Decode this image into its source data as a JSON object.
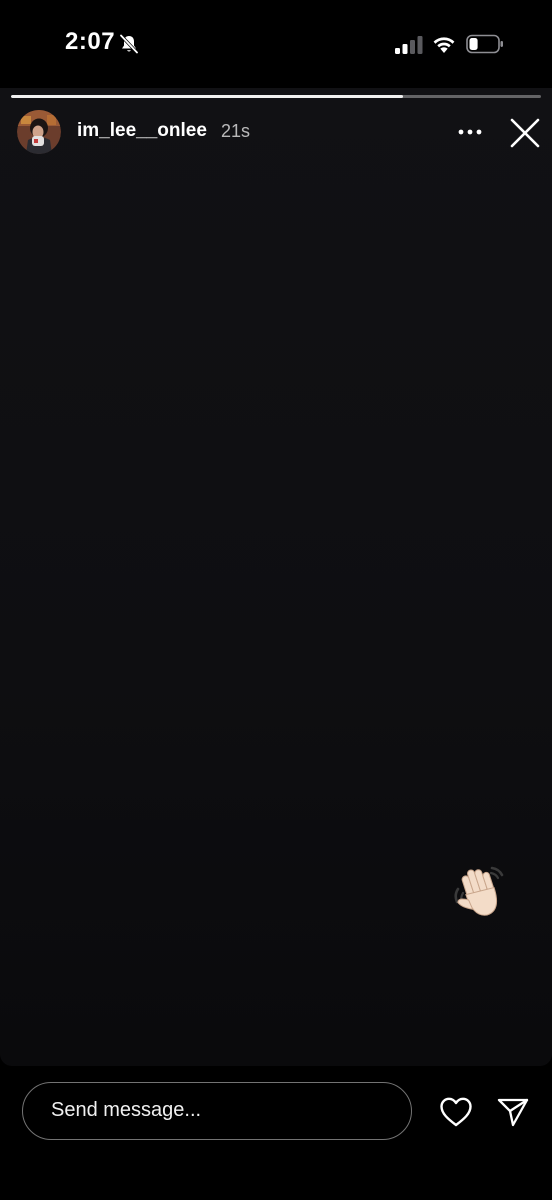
{
  "status_bar": {
    "time": "2:07",
    "silent_icon": "bell-slash-icon",
    "signal_icon": "cellular-signal-icon",
    "wifi_icon": "wifi-icon",
    "battery_icon": "battery-icon",
    "battery_level": 0.3,
    "signal_bars_active": 2
  },
  "story": {
    "progress": 0.74,
    "username": "im_lee__onlee",
    "timestamp": "21s",
    "avatar_icon": "profile-avatar",
    "more_icon": "more-horizontal-icon",
    "close_icon": "close-icon",
    "sticker_icon": "waving-hand-emoji",
    "background_color": "#0e0e11"
  },
  "footer": {
    "message_placeholder": "Send message...",
    "like_icon": "heart-icon",
    "send_icon": "send-icon"
  },
  "colors": {
    "background": "#000000",
    "text": "#ffffff",
    "muted_text": "#b3b3b3"
  }
}
